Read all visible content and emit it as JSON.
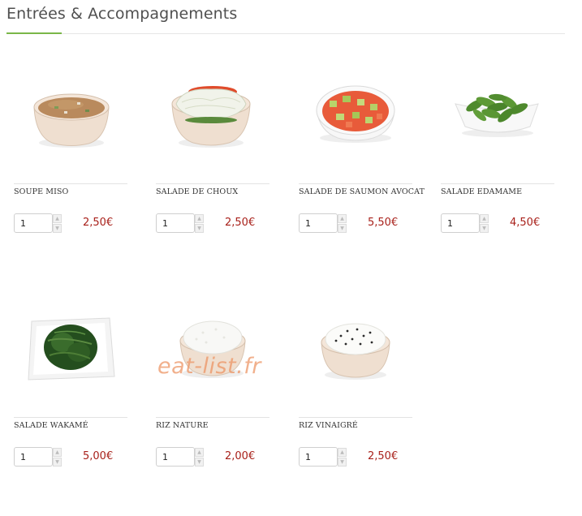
{
  "header": {
    "title": "Entrées & Accompagnements",
    "accent_color": "#7ab648"
  },
  "watermark": "eat-list.fr",
  "price_color": "#a8201a",
  "products": [
    {
      "name": "SOUPE MISO",
      "qty": "1",
      "price": "2,50€",
      "image": "miso-soup-bowl"
    },
    {
      "name": "SALADE DE CHOUX",
      "qty": "1",
      "price": "2,50€",
      "image": "cabbage-salad-bowl"
    },
    {
      "name": "SALADE DE SAUMON AVOCAT",
      "qty": "1",
      "price": "5,50€",
      "image": "salmon-avocado-salad-bowl"
    },
    {
      "name": "SALADE EDAMAME",
      "qty": "1",
      "price": "4,50€",
      "image": "edamame-dish"
    },
    {
      "name": "SALADE WAKAMÉ",
      "qty": "1",
      "price": "5,00€",
      "image": "wakame-plate"
    },
    {
      "name": "RIZ NATURE",
      "qty": "1",
      "price": "2,00€",
      "image": "plain-rice-bowl"
    },
    {
      "name": "RIZ VINAIGRÉ",
      "qty": "1",
      "price": "2,50€",
      "image": "vinegared-rice-bowl"
    }
  ]
}
